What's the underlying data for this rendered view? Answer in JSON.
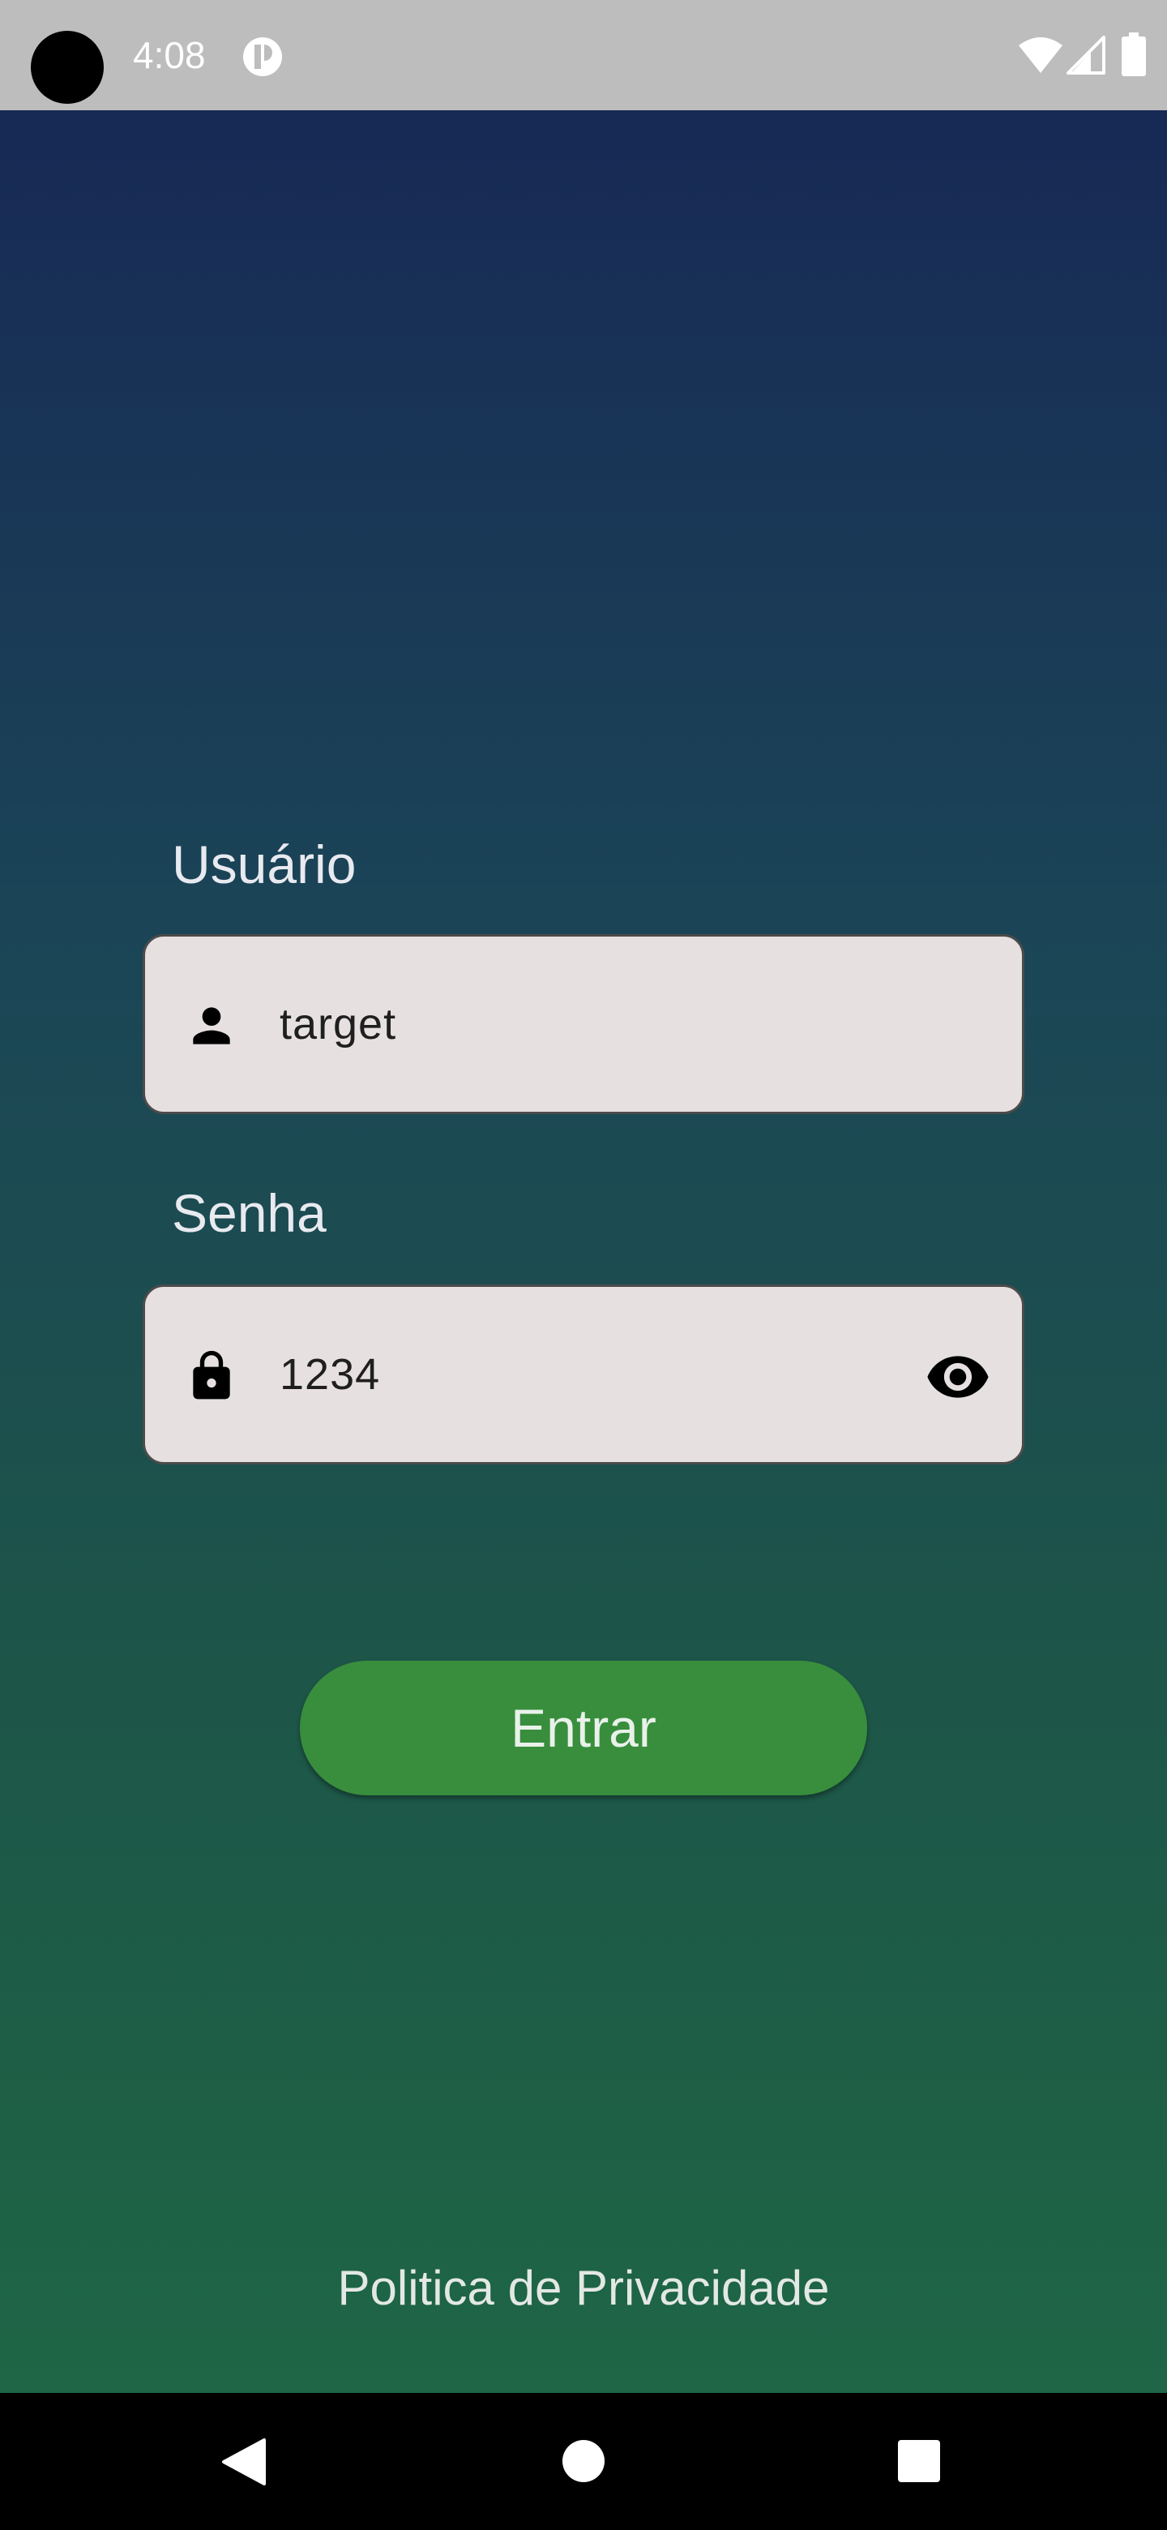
{
  "status_bar": {
    "time": "4:08",
    "icons": [
      "camera-cutout",
      "notification-icon",
      "wifi-icon",
      "cell-signal-icon",
      "battery-icon"
    ]
  },
  "login_form": {
    "username_label": "Usuário",
    "username_value": "target",
    "username_icon": "person-icon",
    "password_label": "Senha",
    "password_value": "1234",
    "password_icon": "lock-icon",
    "password_toggle_icon": "visibility-icon",
    "login_button_label": "Entrar"
  },
  "footer": {
    "privacy_link": "Politica de Privacidade"
  },
  "nav_bar": {
    "icons": [
      "back-icon",
      "home-icon",
      "recents-icon"
    ]
  },
  "colors": {
    "status_bar_bg": "#bdbdbd",
    "gradient_top": "#172955",
    "gradient_bottom": "#1e6645",
    "field_bg": "#e6e0e1",
    "button_bg": "#388e3c",
    "nav_bar_bg": "#000000"
  }
}
